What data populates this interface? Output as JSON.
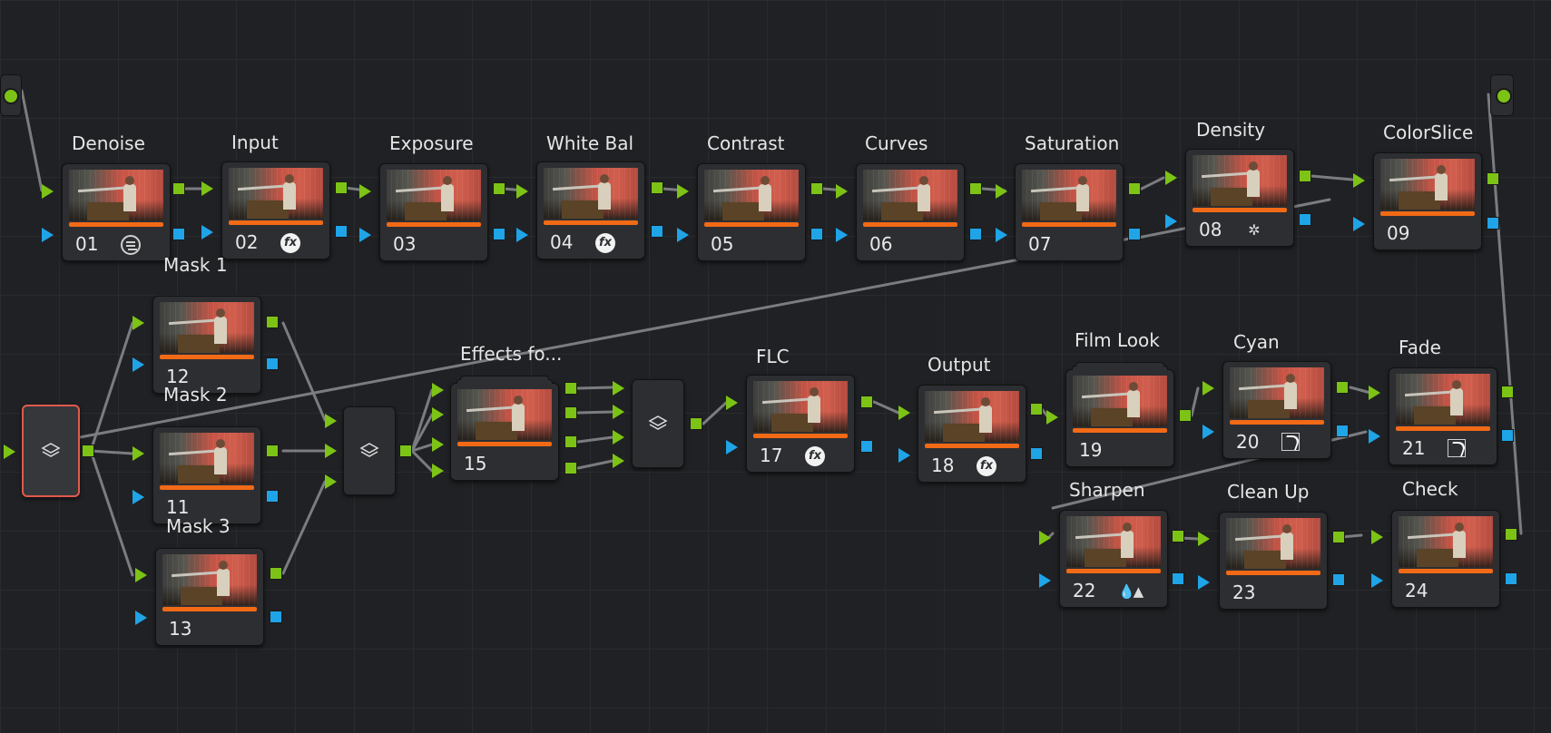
{
  "colors": {
    "background": "#202124",
    "node": "#2d2e32",
    "link": "#7b7c80",
    "rgb_port": "#7cc316",
    "alpha_port": "#1fa4e8",
    "node_bar": "#f26a16",
    "selected_outline": "#e05a4c"
  },
  "nodes": {
    "denoise": {
      "label": "Denoise",
      "number": "01",
      "icon": "denoise-icon"
    },
    "input": {
      "label": "Input",
      "number": "02",
      "icon": "fx-icon"
    },
    "exposure": {
      "label": "Exposure",
      "number": "03"
    },
    "white_bal": {
      "label": "White Bal",
      "number": "04",
      "icon": "fx-icon"
    },
    "contrast": {
      "label": "Contrast",
      "number": "05"
    },
    "curves": {
      "label": "Curves",
      "number": "06"
    },
    "saturation": {
      "label": "Saturation",
      "number": "07"
    },
    "density": {
      "label": "Density",
      "number": "08",
      "icon": "network-icon"
    },
    "colorslice": {
      "label": "ColorSlice",
      "number": "09"
    },
    "mask1": {
      "label": "Mask 1",
      "number": "12"
    },
    "mask2": {
      "label": "Mask 2",
      "number": "11"
    },
    "mask3": {
      "label": "Mask 3",
      "number": "13"
    },
    "effects": {
      "label": "Effects fo...",
      "number": "15"
    },
    "flc": {
      "label": "FLC",
      "number": "17",
      "icon": "fx-icon"
    },
    "output": {
      "label": "Output",
      "number": "18",
      "icon": "fx-icon"
    },
    "film_look": {
      "label": "Film Look",
      "number": "19"
    },
    "cyan": {
      "label": "Cyan",
      "number": "20",
      "icon": "curve-icon"
    },
    "fade": {
      "label": "Fade",
      "number": "21",
      "icon": "curve-icon"
    },
    "sharpen": {
      "label": "Sharpen",
      "number": "22",
      "icon": "sharpen-drops-icon"
    },
    "clean_up": {
      "label": "Clean Up",
      "number": "23"
    },
    "check": {
      "label": "Check",
      "number": "24"
    }
  },
  "icons": {
    "fx": "fx",
    "network": "✲",
    "drops": "💧▲"
  }
}
